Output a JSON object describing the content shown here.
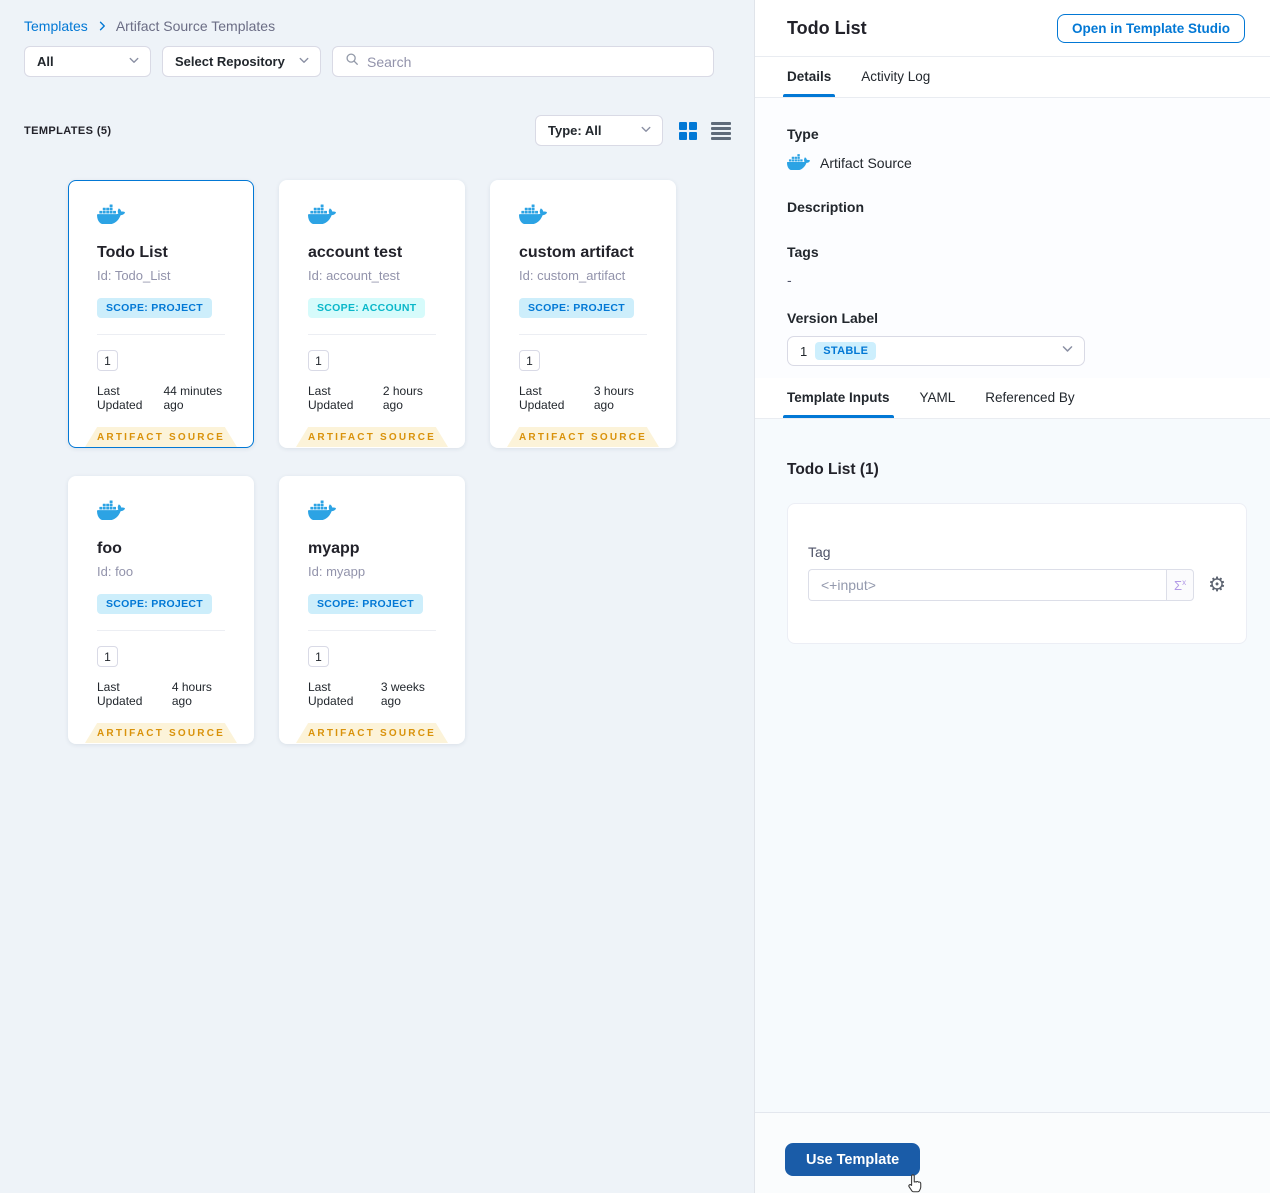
{
  "breadcrumb": {
    "root": "Templates",
    "current": "Artifact Source Templates"
  },
  "filters": {
    "scope_dropdown": "All",
    "repository_dropdown": "Select Repository",
    "search_placeholder": "Search"
  },
  "list_header": {
    "count_label": "TEMPLATES (5)",
    "type_dropdown": "Type: All"
  },
  "cards": [
    {
      "title": "Todo List",
      "id": "Id: Todo_List",
      "scope": "SCOPE: PROJECT",
      "scope_type": "project",
      "version": "1",
      "last_updated_label": "Last Updated",
      "last_updated": "44 minutes ago",
      "ribbon": "ARTIFACT SOURCE",
      "selected": true
    },
    {
      "title": "account test",
      "id": "Id: account_test",
      "scope": "SCOPE: ACCOUNT",
      "scope_type": "account",
      "version": "1",
      "last_updated_label": "Last Updated",
      "last_updated": "2 hours ago",
      "ribbon": "ARTIFACT SOURCE",
      "selected": false
    },
    {
      "title": "custom artifact",
      "id": "Id: custom_artifact",
      "scope": "SCOPE: PROJECT",
      "scope_type": "project",
      "version": "1",
      "last_updated_label": "Last Updated",
      "last_updated": "3 hours ago",
      "ribbon": "ARTIFACT SOURCE",
      "selected": false
    },
    {
      "title": "foo",
      "id": "Id: foo",
      "scope": "SCOPE: PROJECT",
      "scope_type": "project",
      "version": "1",
      "last_updated_label": "Last Updated",
      "last_updated": "4 hours ago",
      "ribbon": "ARTIFACT SOURCE",
      "selected": false
    },
    {
      "title": "myapp",
      "id": "Id: myapp",
      "scope": "SCOPE: PROJECT",
      "scope_type": "project",
      "version": "1",
      "last_updated_label": "Last Updated",
      "last_updated": "3 weeks ago",
      "ribbon": "ARTIFACT SOURCE",
      "selected": false
    }
  ],
  "details_panel": {
    "title": "Todo List",
    "open_button": "Open in Template Studio",
    "tabs": [
      "Details",
      "Activity Log"
    ],
    "type_label": "Type",
    "type_value": "Artifact Source",
    "description_label": "Description",
    "tags_label": "Tags",
    "tags_value": "-",
    "version_label": "Version Label",
    "version_value": "1",
    "version_badge": "STABLE",
    "inputs_tabs": [
      "Template Inputs",
      "YAML",
      "Referenced By"
    ],
    "inputs_heading": "Todo List (1)",
    "tag_label": "Tag",
    "tag_value": "<+input>",
    "sigma_label": "Σ",
    "use_template_button": "Use Template"
  },
  "icons": {
    "breadcrumb_separator": "chevron-right-icon",
    "search": "search-icon",
    "dropdown": "chevron-down-icon",
    "grid_view": "grid-view-icon",
    "list_view": "list-view-icon",
    "template_type": "docker-whale-icon",
    "expression": "sigma-x-icon",
    "settings": "gear-icon",
    "pointer": "hand-cursor-icon"
  },
  "colors": {
    "accent_blue": "#0278d5",
    "primary_button": "#1a5ca8",
    "docker_blue": "#2ca3e4",
    "ribbon_bg": "#fcf3d9",
    "ribbon_text": "#d9920b",
    "scope_project_bg": "#cdeefb",
    "scope_account_text": "#0ab7c9",
    "left_background": "#eef3f8",
    "inputs_background": "#f6fafd"
  }
}
